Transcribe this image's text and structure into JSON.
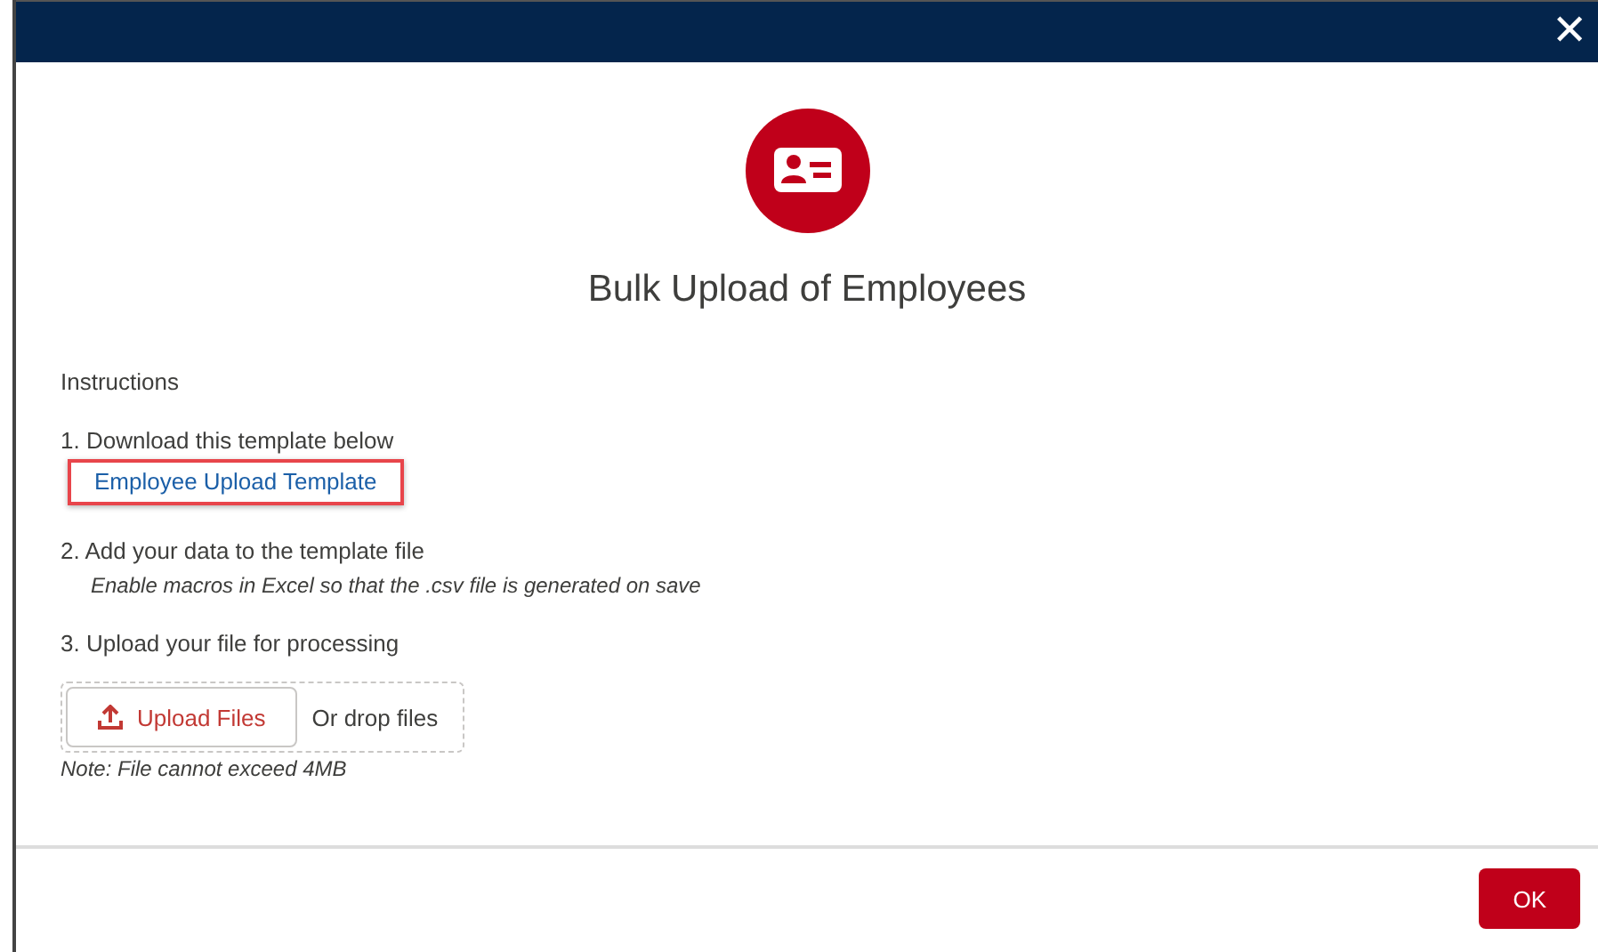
{
  "dialog": {
    "close": "✕",
    "title": "Bulk Upload of Employees"
  },
  "instructions": {
    "heading": "Instructions",
    "steps": [
      {
        "kind": "link",
        "text": "1. Download this template below",
        "link": {
          "label": "Employee Upload Template",
          "highlighted": true
        }
      },
      {
        "kind": "note",
        "text": "2. Add your data to the template file",
        "note": "Enable macros in Excel so that the .csv file is generated on save"
      },
      {
        "kind": "upload",
        "text": "3. Upload your file for processing",
        "upload": {
          "button": "Upload Files",
          "drop": "Or drop files",
          "note": "Note: File cannot exceed 4MB"
        }
      }
    ]
  },
  "footer": {
    "buttons": [
      "OK"
    ]
  }
}
